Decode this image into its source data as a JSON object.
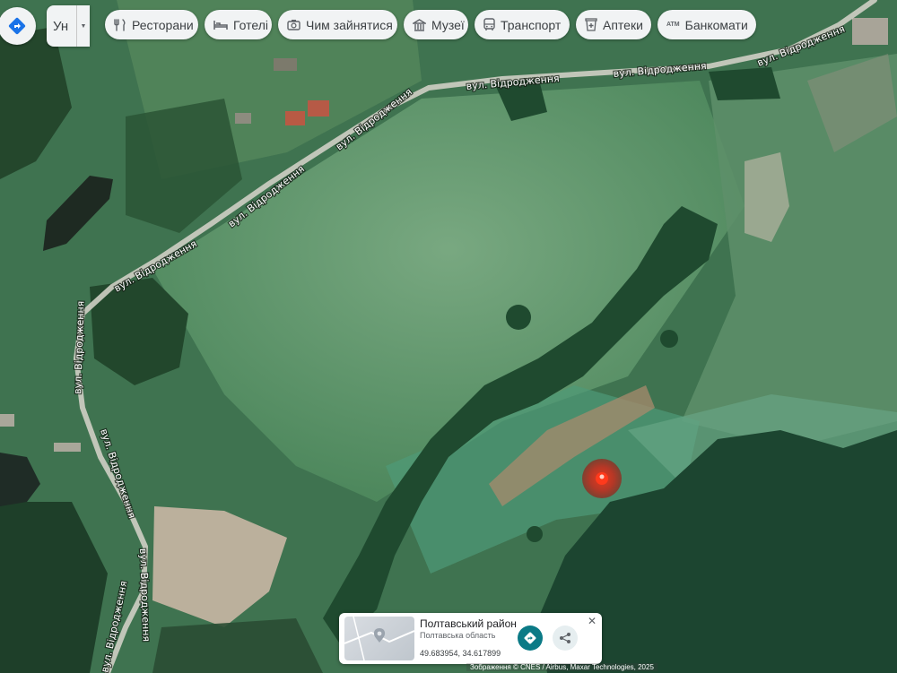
{
  "colors": {
    "accent": "#0b7a86",
    "marker": "#e8301c",
    "chip_bg": "#f1f3f4"
  },
  "nav_button": {
    "icon": "directions-diamond-icon"
  },
  "user_menu": {
    "initials": "Ун",
    "caret_icon": "caret-down-icon"
  },
  "category_chips": [
    {
      "label": "Ресторани",
      "icon": "utensils-icon"
    },
    {
      "label": "Готелі",
      "icon": "bed-icon"
    },
    {
      "label": "Чим зайнятися",
      "icon": "camera-icon"
    },
    {
      "label": "Музеї",
      "icon": "museum-icon"
    },
    {
      "label": "Транспорт",
      "icon": "bus-icon"
    },
    {
      "label": "Аптеки",
      "icon": "pharmacy-icon"
    },
    {
      "label": "Банкомати",
      "icon": "atm-icon",
      "icon_text": "ATM"
    }
  ],
  "map": {
    "road_name": "вул. Відродження",
    "marker_icon": "location-pin-icon"
  },
  "place_card": {
    "title": "Полтавський район",
    "subtitle": "Полтавська область",
    "coordinates": "49.683954, 34.617899",
    "close_icon": "close-icon",
    "directions_icon": "directions-diamond-icon",
    "share_icon": "share-icon"
  },
  "attribution": "Зображення © CNES / Airbus, Maxar Technologies, 2025"
}
